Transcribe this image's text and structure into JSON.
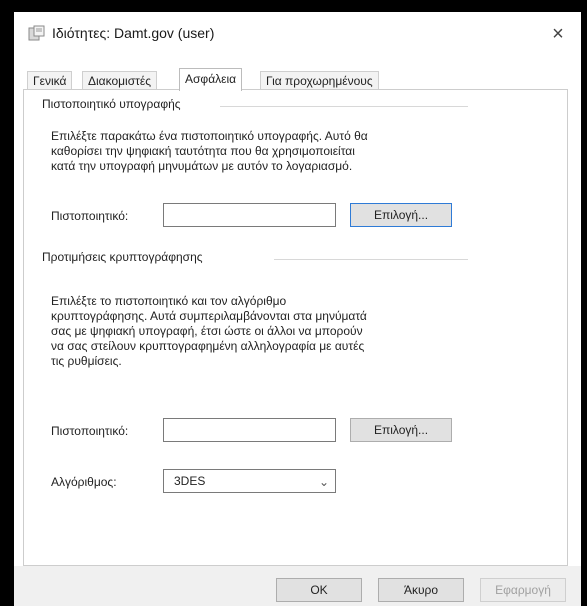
{
  "window": {
    "title": "Ιδιότητες: Damt.gov (user)",
    "close_glyph": "×"
  },
  "tabs": [
    {
      "label": "Γενικά",
      "active": false
    },
    {
      "label": "Διακομιστές",
      "active": false
    },
    {
      "label": "Ασφάλεια",
      "active": true
    },
    {
      "label": "Για προχωρημένους",
      "active": false
    }
  ],
  "signing": {
    "title": "Πιστοποιητικό υπογραφής",
    "desc": [
      "Επιλέξτε παρακάτω ένα πιστοποιητικό υπογραφής. Αυτό θα",
      "καθορίσει την ψηφιακή ταυτότητα που θα χρησιμοποιείται",
      "κατά την υπογραφή μηνυμάτων με αυτόν το λογαριασμό."
    ],
    "cert_label": "Πιστοποιητικό:",
    "cert_value": "",
    "select_button": "Επιλογή..."
  },
  "encryption": {
    "title": "Προτιμήσεις κρυπτογράφησης",
    "desc": [
      "Επιλέξτε το πιστοποιητικό και τον αλγόριθμο",
      "κρυπτογράφησης. Αυτά συμπεριλαμβάνονται στα μηνύματά",
      "σας με ψηφιακή υπογραφή, έτσι ώστε οι άλλοι να μπορούν",
      "να σας στείλουν κρυπτογραφημένη αλληλογραφία με αυτές",
      "τις ρυθμίσεις."
    ],
    "cert_label": "Πιστοποιητικό:",
    "cert_value": "",
    "select_button": "Επιλογή...",
    "algo_label": "Αλγόριθμος:",
    "algo_value": "3DES"
  },
  "footer": {
    "ok": "OK",
    "cancel": "Άκυρο",
    "apply": "Εφαρμογή"
  },
  "icons": {
    "app": "mail-account-icon",
    "close": "close-icon",
    "dropdown": "chevron-down-icon"
  }
}
